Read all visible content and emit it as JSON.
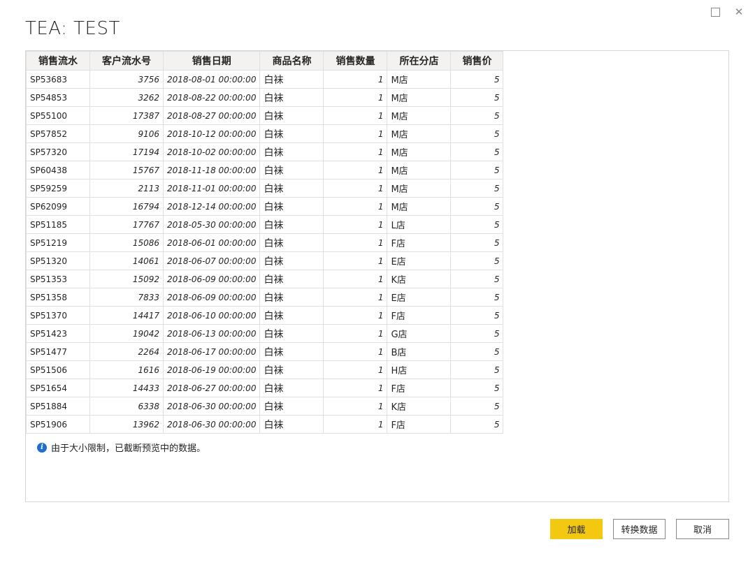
{
  "window": {
    "maximize_icon": "maximize-icon",
    "close_icon": "close-icon",
    "close_glyph": "✕"
  },
  "title": "TEA: TEST",
  "table": {
    "columns": [
      "销售流水",
      "客户流水号",
      "销售日期",
      "商品名称",
      "销售数量",
      "所在分店",
      "销售价"
    ],
    "rows": [
      [
        "SP53683",
        "3756",
        "2018-08-01 00:00:00",
        "白袜",
        "1",
        "M店",
        "5"
      ],
      [
        "SP54853",
        "3262",
        "2018-08-22 00:00:00",
        "白袜",
        "1",
        "M店",
        "5"
      ],
      [
        "SP55100",
        "17387",
        "2018-08-27 00:00:00",
        "白袜",
        "1",
        "M店",
        "5"
      ],
      [
        "SP57852",
        "9106",
        "2018-10-12 00:00:00",
        "白袜",
        "1",
        "M店",
        "5"
      ],
      [
        "SP57320",
        "17194",
        "2018-10-02 00:00:00",
        "白袜",
        "1",
        "M店",
        "5"
      ],
      [
        "SP60438",
        "15767",
        "2018-11-18 00:00:00",
        "白袜",
        "1",
        "M店",
        "5"
      ],
      [
        "SP59259",
        "2113",
        "2018-11-01 00:00:00",
        "白袜",
        "1",
        "M店",
        "5"
      ],
      [
        "SP62099",
        "16794",
        "2018-12-14 00:00:00",
        "白袜",
        "1",
        "M店",
        "5"
      ],
      [
        "SP51185",
        "17767",
        "2018-05-30 00:00:00",
        "白袜",
        "1",
        "L店",
        "5"
      ],
      [
        "SP51219",
        "15086",
        "2018-06-01 00:00:00",
        "白袜",
        "1",
        "F店",
        "5"
      ],
      [
        "SP51320",
        "14061",
        "2018-06-07 00:00:00",
        "白袜",
        "1",
        "E店",
        "5"
      ],
      [
        "SP51353",
        "15092",
        "2018-06-09 00:00:00",
        "白袜",
        "1",
        "K店",
        "5"
      ],
      [
        "SP51358",
        "7833",
        "2018-06-09 00:00:00",
        "白袜",
        "1",
        "E店",
        "5"
      ],
      [
        "SP51370",
        "14417",
        "2018-06-10 00:00:00",
        "白袜",
        "1",
        "F店",
        "5"
      ],
      [
        "SP51423",
        "19042",
        "2018-06-13 00:00:00",
        "白袜",
        "1",
        "G店",
        "5"
      ],
      [
        "SP51477",
        "2264",
        "2018-06-17 00:00:00",
        "白袜",
        "1",
        "B店",
        "5"
      ],
      [
        "SP51506",
        "1616",
        "2018-06-19 00:00:00",
        "白袜",
        "1",
        "H店",
        "5"
      ],
      [
        "SP51654",
        "14433",
        "2018-06-27 00:00:00",
        "白袜",
        "1",
        "F店",
        "5"
      ],
      [
        "SP51884",
        "6338",
        "2018-06-30 00:00:00",
        "白袜",
        "1",
        "K店",
        "5"
      ],
      [
        "SP51906",
        "13962",
        "2018-06-30 00:00:00",
        "白袜",
        "1",
        "F店",
        "5"
      ]
    ]
  },
  "info": {
    "icon": "info-icon",
    "text": "由于大小限制，已截断预览中的数据。"
  },
  "buttons": {
    "load": "加载",
    "transform": "转换数据",
    "cancel": "取消"
  },
  "colors": {
    "accent": "#f2c811",
    "info_icon": "#1f6fd1"
  }
}
